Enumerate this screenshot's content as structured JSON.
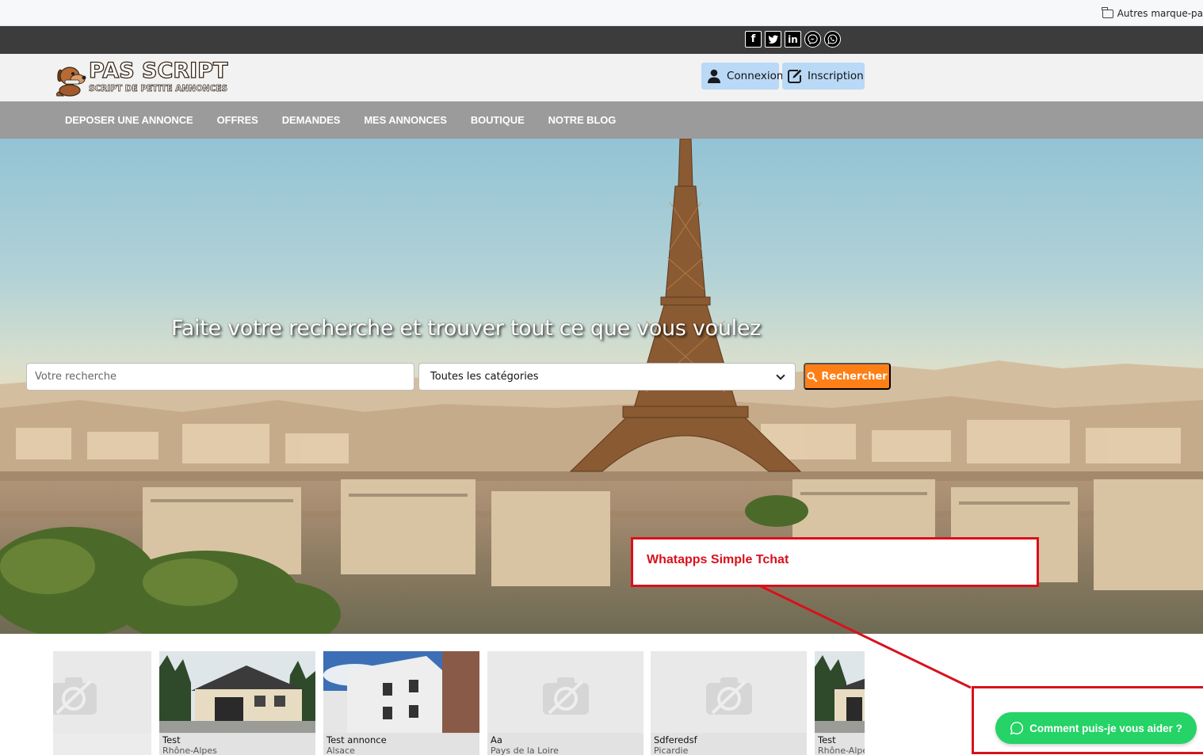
{
  "browser": {
    "bookmark_folder": "Autres marque-pa"
  },
  "social": {
    "icons": [
      "facebook-icon",
      "twitter-icon",
      "linkedin-icon",
      "messenger-icon",
      "whatsapp-icon"
    ]
  },
  "header": {
    "logo_title": "PAS SCRIPT",
    "logo_subtitle": "SCRIPT DE PETITE ANNONCES",
    "login_label": "Connexion",
    "register_label": "Inscription",
    "auth_button_color": "#b9d9f6"
  },
  "nav": {
    "items": [
      "DEPOSER UNE ANNONCE",
      "OFFRES",
      "DEMANDES",
      "MES ANNONCES",
      "BOUTIQUE",
      "NOTRE BLOG"
    ],
    "background": "#9b9b9b"
  },
  "hero": {
    "title": "Faite votre recherche et trouver tout ce que vous voulez",
    "search_placeholder": "Votre recherche",
    "category_selected": "Toutes les catégories",
    "search_button": "Rechercher",
    "search_button_color": "#ff7f17"
  },
  "annotation": {
    "label": "Whatapps Simple Tchat",
    "color": "#d8111c"
  },
  "listings": [
    {
      "title": "",
      "region": "",
      "image": "placeholder"
    },
    {
      "title": "Test",
      "region": "Rhône-Alpes",
      "image": "house-photo"
    },
    {
      "title": "Test annonce",
      "region": "Alsace",
      "image": "building-photo"
    },
    {
      "title": "Aa",
      "region": "Pays de la Loire",
      "image": "placeholder"
    },
    {
      "title": "Sdferedsf",
      "region": "Picardie",
      "image": "placeholder"
    },
    {
      "title": "Test",
      "region": "Rhône-Alpes",
      "image": "house-photo"
    }
  ],
  "chat": {
    "label": "Comment puis-je vous aider ?",
    "color": "#25d366"
  }
}
